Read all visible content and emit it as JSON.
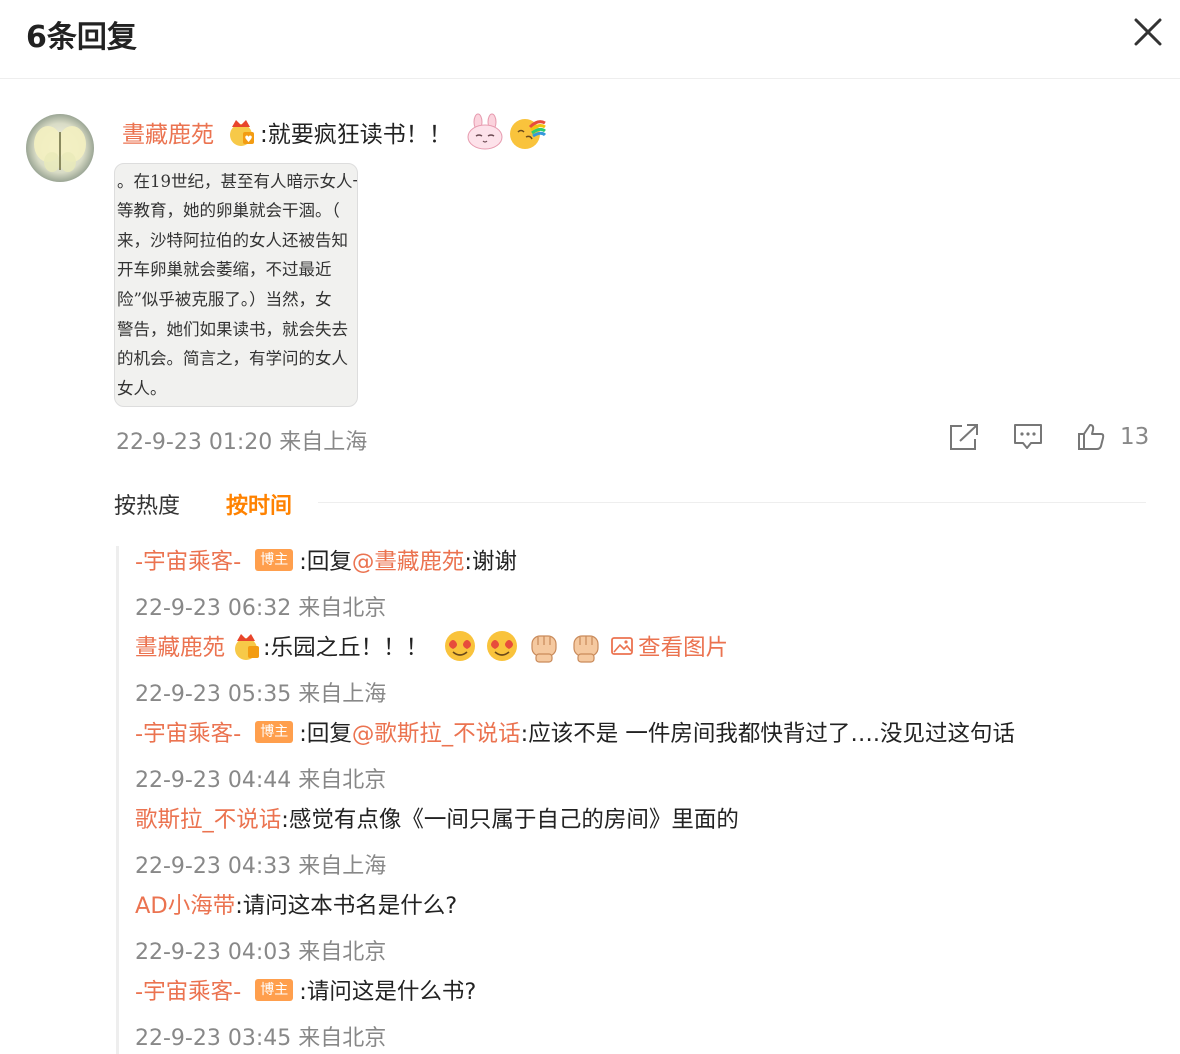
{
  "header": {
    "title": "6条回复"
  },
  "comment": {
    "username": "晝藏鹿苑",
    "text": ":就要疯狂读书！！",
    "image_lines": [
      "。在19世纪，甚至有人暗示女人一",
      "等教育，她的卵巢就会干涸。（",
      "来，沙特阿拉伯的女人还被告知",
      "开车卵巢就会萎缩，不过最近",
      "险”似乎被克服了。）当然，女",
      "警告，她们如果读书，就会失去",
      "的机会。简言之，有学问的女人",
      "女人。"
    ],
    "time": "22-9-23 01:20",
    "location": "来自上海",
    "likes": "13"
  },
  "sort": {
    "hot": "按热度",
    "time": "按时间"
  },
  "replies": [
    {
      "user": "-宇宙乘客-",
      "tag": "博主",
      "sep": ":回复",
      "mention": "@晝藏鹿苑",
      "text": ":谢谢",
      "time": "22-9-23 06:32",
      "location": "来自北京"
    },
    {
      "user": "晝藏鹿苑",
      "text": ":乐园之丘！！！",
      "view_image": "查看图片",
      "time": "22-9-23 05:35",
      "location": "来自上海"
    },
    {
      "user": "-宇宙乘客-",
      "tag": "博主",
      "sep": ":回复",
      "mention": "@歌斯拉_不说话",
      "text": ":应该不是 一件房间我都快背过了….没见过这句话",
      "time": "22-9-23 04:44",
      "location": "来自北京"
    },
    {
      "user": "歌斯拉_不说话",
      "text": ":感觉有点像《一间只属于自己的房间》里面的",
      "time": "22-9-23 04:33",
      "location": "来自上海"
    },
    {
      "user": "AD小海带",
      "text": ":请问这本书名是什么?",
      "time": "22-9-23 04:03",
      "location": "来自北京"
    },
    {
      "user": "-宇宙乘客-",
      "tag": "博主",
      "text": ":请问这是什么书?",
      "time": "22-9-23 03:45",
      "location": "来自北京"
    }
  ],
  "colors": {
    "accent": "#eb7350",
    "active_sort": "#ff8200",
    "tag": "#ff9f4d",
    "meta": "#888888"
  },
  "icons": [
    "close-icon",
    "crown-badge-icon",
    "bunny-emoji-icon",
    "rainbow-emoji-icon",
    "share-icon",
    "comment-icon",
    "like-icon",
    "heart-eyes-emoji-icon",
    "fist-emoji-icon",
    "image-icon"
  ]
}
